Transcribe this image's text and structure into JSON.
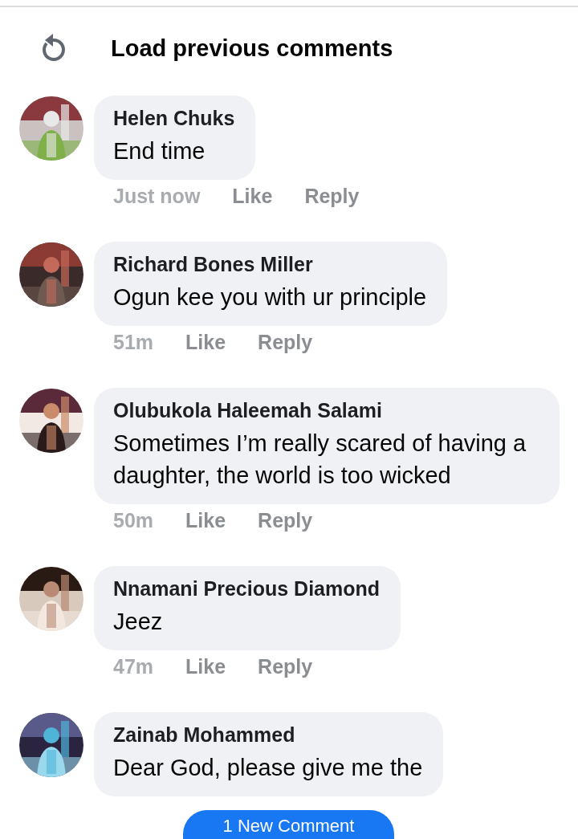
{
  "load_previous": {
    "label": "Load previous comments"
  },
  "comments": [
    {
      "author": "Helen Chuks",
      "text": "End time",
      "time": "Just now",
      "like": "Like",
      "reply": "Reply"
    },
    {
      "author": "Richard Bones Miller",
      "text": "Ogun kee you with ur principle",
      "time": "51m",
      "like": "Like",
      "reply": "Reply"
    },
    {
      "author": "Olubukola Haleemah Salami",
      "text": "Sometimes I’m really scared of having a daughter, the world is too wicked",
      "time": "50m",
      "like": "Like",
      "reply": "Reply"
    },
    {
      "author": "Nnamani Precious Diamond",
      "text": "Jeez",
      "time": "47m",
      "like": "Like",
      "reply": "Reply"
    },
    {
      "author": "Zainab Mohammed",
      "text": "Dear God, please give me the"
    }
  ],
  "new_comment_button": {
    "label": "1 New Comment"
  }
}
